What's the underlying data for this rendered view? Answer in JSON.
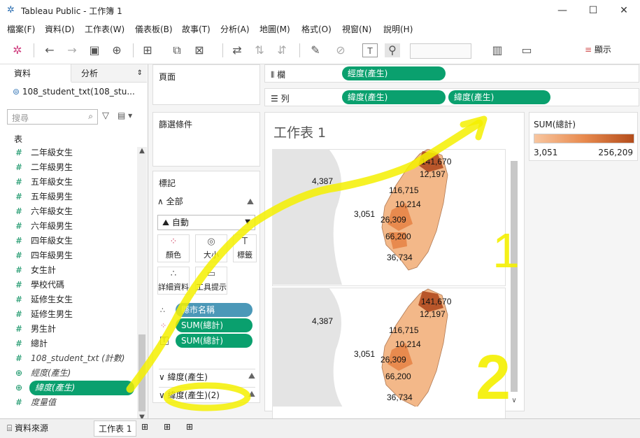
{
  "window": {
    "title": "Tableau Public - 工作簿 1",
    "minimize": "—",
    "maximize": "☐",
    "close": "✕"
  },
  "menu": [
    "檔案(F)",
    "資料(D)",
    "工作表(W)",
    "儀表板(B)",
    "故事(T)",
    "分析(A)",
    "地圖(M)",
    "格式(O)",
    "視窗(N)",
    "說明(H)"
  ],
  "toolbar": {
    "show_label": "顯示"
  },
  "data_pane": {
    "tab_data": "資料",
    "tab_analysis": "分析",
    "datasource": "108_student_txt(108_stu...",
    "search_placeholder": "搜尋",
    "tables_header": "表",
    "fields": [
      {
        "label": "二年級女生",
        "type": "measure"
      },
      {
        "label": "二年級男生",
        "type": "measure"
      },
      {
        "label": "五年級女生",
        "type": "measure"
      },
      {
        "label": "五年級男生",
        "type": "measure"
      },
      {
        "label": "六年級女生",
        "type": "measure"
      },
      {
        "label": "六年級男生",
        "type": "measure"
      },
      {
        "label": "四年級女生",
        "type": "measure"
      },
      {
        "label": "四年級男生",
        "type": "measure"
      },
      {
        "label": "女生計",
        "type": "measure"
      },
      {
        "label": "學校代碼",
        "type": "measure"
      },
      {
        "label": "延修生女生",
        "type": "measure"
      },
      {
        "label": "延修生男生",
        "type": "measure"
      },
      {
        "label": "男生計",
        "type": "measure"
      },
      {
        "label": "總計",
        "type": "measure"
      },
      {
        "label": "108_student_txt (計數)",
        "type": "measure-italic"
      },
      {
        "label": "經度(產生)",
        "type": "geo"
      },
      {
        "label": "緯度(產生)",
        "type": "geo-selected"
      },
      {
        "label": "度量值",
        "type": "measure-italic"
      }
    ]
  },
  "pages": {
    "title": "頁面"
  },
  "filters": {
    "title": "篩選條件"
  },
  "marks": {
    "title": "標記",
    "all_label": "全部",
    "mark_type": "自動",
    "buttons": {
      "color": "顏色",
      "size": "大小",
      "label": "標籤",
      "detail": "詳細資料",
      "tooltip": "工具提示"
    },
    "pills": [
      "縣市名稱",
      "SUM(總計)",
      "SUM(總計)"
    ],
    "lat1": "緯度(產生)",
    "lat2": "緯度(產生)(2)"
  },
  "shelves": {
    "columns_label": "欄",
    "rows_label": "列",
    "columns_pills": [
      "經度(產生)"
    ],
    "rows_pills": [
      "緯度(產生)",
      "緯度(產生)"
    ]
  },
  "view": {
    "sheet_title": "工作表 1",
    "map_labels": [
      "141,670",
      "12,197",
      "4,387",
      "116,715",
      "10,214",
      "3,051",
      "26,309",
      "66,200",
      "36,734"
    ]
  },
  "legend": {
    "title": "SUM(總計)",
    "min": "3,051",
    "max": "256,209"
  },
  "bottom_tabs": {
    "datasource": "資料來源",
    "sheet": "工作表 1"
  },
  "annotations": {
    "mark1": "1",
    "mark2": "2"
  }
}
